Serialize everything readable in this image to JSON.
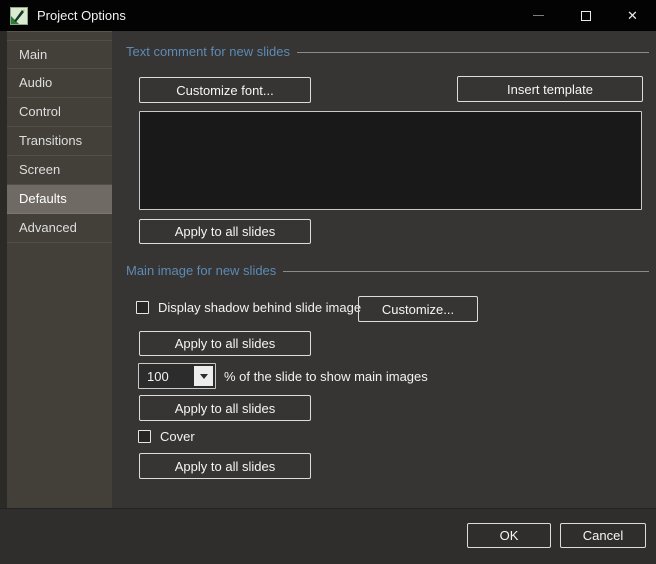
{
  "window": {
    "title": "Project Options",
    "controls": {
      "minimize_icon": "minimize-icon",
      "maximize_icon": "maximize-icon",
      "close_icon": "close-icon",
      "close_glyph": "✕"
    },
    "app_icon": "pte-slide-editor-icon"
  },
  "sidebar": {
    "items": [
      {
        "label": "Main",
        "selected": false
      },
      {
        "label": "Audio",
        "selected": false
      },
      {
        "label": "Control",
        "selected": false
      },
      {
        "label": "Transitions",
        "selected": false
      },
      {
        "label": "Screen",
        "selected": false
      },
      {
        "label": "Defaults",
        "selected": true
      },
      {
        "label": "Advanced",
        "selected": false
      }
    ]
  },
  "sections": {
    "text_comment": {
      "title": "Text comment for new slides",
      "customize_font_label": "Customize font...",
      "insert_template_label": "Insert template",
      "comment_value": "",
      "apply_label": "Apply to all slides"
    },
    "main_image": {
      "title": "Main image for new slides",
      "shadow_checkbox_label": "Display shadow behind slide image",
      "shadow_checked": false,
      "customize_label": "Customize...",
      "apply_shadow_label": "Apply to all slides",
      "percent_value": "100",
      "percent_label": "% of the slide to show main images",
      "apply_percent_label": "Apply to all slides",
      "cover_checkbox_label": "Cover",
      "cover_checked": false,
      "apply_cover_label": "Apply to all slides"
    }
  },
  "footer": {
    "ok_label": "OK",
    "cancel_label": "Cancel"
  },
  "colors": {
    "titlebar_bg": "#030303",
    "content_bg": "#363534",
    "sidebar_bg": "#43403a",
    "sidebar_selected_bg": "#6f6b64",
    "section_header_text": "#5d8ab4",
    "button_border": "#dcdcdc",
    "comment_box_bg": "#191919"
  }
}
